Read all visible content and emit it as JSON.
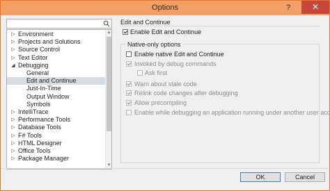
{
  "window": {
    "title": "Options",
    "help": "?",
    "close": "✕"
  },
  "search": {
    "value": "",
    "placeholder": ""
  },
  "tree": {
    "items": [
      {
        "label": "Environment",
        "arrow": "▷"
      },
      {
        "label": "Projects and Solutions",
        "arrow": "▷"
      },
      {
        "label": "Source Control",
        "arrow": "▷"
      },
      {
        "label": "Text Editor",
        "arrow": "▷"
      },
      {
        "label": "Debugging",
        "arrow": "◢"
      },
      {
        "label": "General",
        "arrow": ""
      },
      {
        "label": "Edit and Continue",
        "arrow": ""
      },
      {
        "label": "Just-In-Time",
        "arrow": ""
      },
      {
        "label": "Output Window",
        "arrow": ""
      },
      {
        "label": "Symbols",
        "arrow": ""
      },
      {
        "label": "IntelliTrace",
        "arrow": "▷"
      },
      {
        "label": "Performance Tools",
        "arrow": "▷"
      },
      {
        "label": "Database Tools",
        "arrow": "▷"
      },
      {
        "label": "F# Tools",
        "arrow": "▷"
      },
      {
        "label": "HTML Designer",
        "arrow": "▷"
      },
      {
        "label": "Office Tools",
        "arrow": "▷"
      },
      {
        "label": "Package Manager",
        "arrow": "▷"
      }
    ],
    "selected": "Edit and Continue"
  },
  "panel": {
    "section_title": "Edit and Continue",
    "enable_label": "Enable Edit and Continue",
    "group_title": "Native-only options",
    "options": {
      "native": "Enable native Edit and Continue",
      "invoked": "Invoked by debug commands",
      "ask_first": "Ask first",
      "warn_stale": "Warn about stale code",
      "relink": "Relink code changes after debugging",
      "precompiling": "Allow precompiling",
      "other_user": "Enable while debugging an application running under another user account"
    }
  },
  "buttons": {
    "ok": "OK",
    "cancel": "Cancel"
  },
  "icons": {
    "search": "search-icon",
    "collapsed": "triangle-right-icon",
    "expanded": "triangle-down-icon"
  },
  "colors": {
    "titlebar": "#f3a066",
    "close": "#c7463a",
    "selection": "#d6dce3"
  }
}
